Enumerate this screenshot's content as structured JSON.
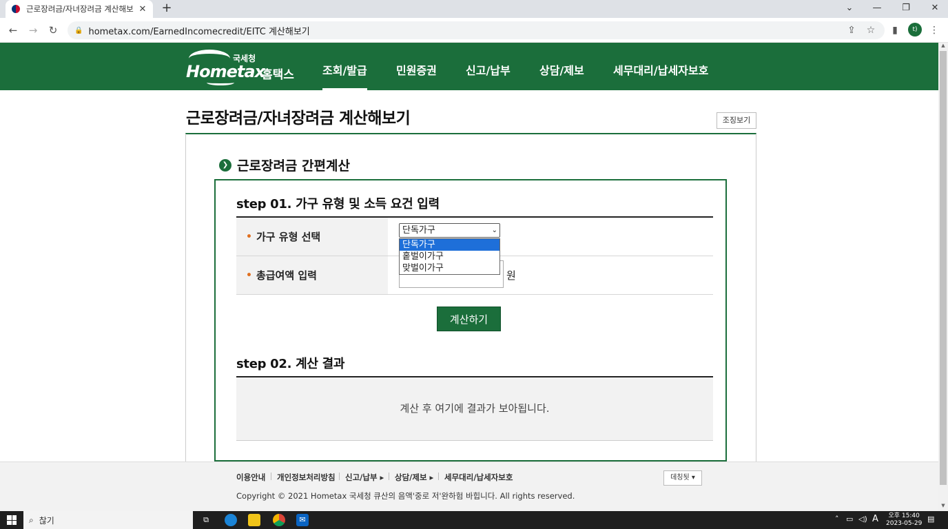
{
  "browser": {
    "tab_title": "근로장려금/자녀장려금 계산해보",
    "new_tab": "+",
    "url": "hometax.com/EarnedIncomecredit/EITC 계산해보기",
    "profile_initial": "t)"
  },
  "site": {
    "logo_top": "국세청",
    "logo_en": "Hometax",
    "logo_kr": "홈택스",
    "nav": [
      "조회/발급",
      "민원증권",
      "신고/납부",
      "상담/제보",
      "세무대리/납세자보호"
    ],
    "brand_color": "#1b6e3b"
  },
  "page": {
    "title": "근로장려금/자녀장려금 계산해보기",
    "org_button": "조징보기",
    "section_title": "근로장려금 간편계산",
    "step1_title": "step 01. 가구 유형 및 소득 요건 입력",
    "household_label": "가구 유형 선택",
    "household_selected": "단독가구",
    "household_options": [
      "단독가구",
      "홑벌이가구",
      "맞벌이가구"
    ],
    "income_label": "총급여액 입력",
    "income_unit": "원",
    "calc_button": "계산하기",
    "step2_title": "step 02. 계산 결과",
    "result_placeholder": "계산 후 여기에 결과가 보아됩니다."
  },
  "footer": {
    "links": [
      "이용안내",
      "개인정보처리방침",
      "신고/납부 ▸",
      "상담/제보 ▸",
      "세무대리/납세자보호"
    ],
    "copyright": "Copyright © 2021 Hometax 국세청 큐산의 음액'중로 저'완하험 바힙니다. All rights reserved.",
    "family_site": "데칭됫 ▾"
  },
  "taskbar": {
    "search_placeholder": "찮기",
    "time": "오후 15:40",
    "date": "2023-05-29",
    "ime": "A"
  }
}
